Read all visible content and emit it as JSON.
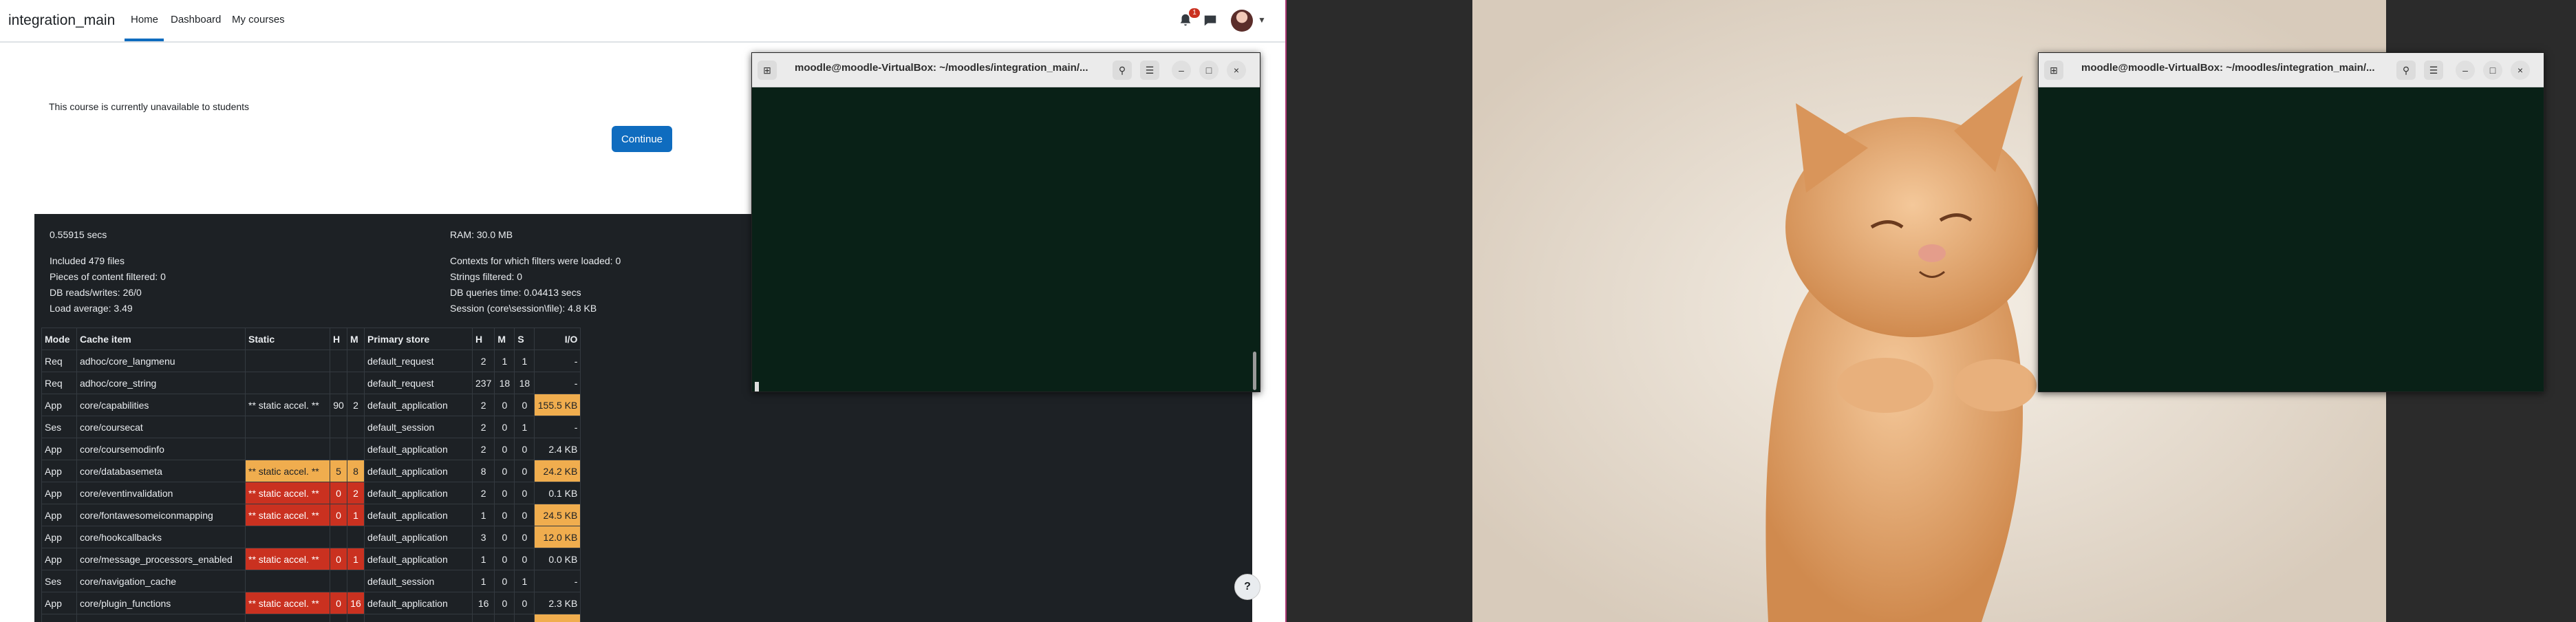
{
  "browser": {
    "site_name": "integration_main",
    "nav": [
      "Home",
      "Dashboard",
      "My courses"
    ],
    "notification_count": "1",
    "notice": "This course is currently unavailable to students",
    "continue_label": "Continue",
    "help_label": "?"
  },
  "perf": {
    "time": "0.55915 secs",
    "ram": "RAM: 30.0 MB",
    "included": "Included 479 files",
    "filtered": "Pieces of content filtered: 0",
    "db_rw": "DB reads/writes: 26/0",
    "load": "Load average: 3.49",
    "contexts": "Contexts for which filters were loaded: 0",
    "strings": "Strings filtered: 0",
    "db_time": "DB queries time: 0.04413 secs",
    "session": "Session (core\\session\\file): 4.8 KB"
  },
  "cache_table": {
    "headers": [
      "Mode",
      "Cache item",
      "Static",
      "H",
      "M",
      "Primary store",
      "H",
      "M",
      "S",
      "I/O"
    ],
    "rows": [
      {
        "mode": "Req",
        "item": "adhoc/core_langmenu",
        "static": "",
        "sh": "",
        "sm": "",
        "store": "default_request",
        "h": "2",
        "m": "1",
        "s": "1",
        "io": "-",
        "st": "",
        "ioc": ""
      },
      {
        "mode": "Req",
        "item": "adhoc/core_string",
        "static": "",
        "sh": "",
        "sm": "",
        "store": "default_request",
        "h": "237",
        "m": "18",
        "s": "18",
        "io": "-",
        "st": "",
        "ioc": ""
      },
      {
        "mode": "App",
        "item": "core/capabilities",
        "static": "** static accel. **",
        "sh": "90",
        "sm": "2",
        "store": "default_application",
        "h": "2",
        "m": "0",
        "s": "0",
        "io": "155.5 KB",
        "st": "",
        "ioc": "orange"
      },
      {
        "mode": "Ses",
        "item": "core/coursecat",
        "static": "",
        "sh": "",
        "sm": "",
        "store": "default_session",
        "h": "2",
        "m": "0",
        "s": "1",
        "io": "-",
        "st": "",
        "ioc": ""
      },
      {
        "mode": "App",
        "item": "core/coursemodinfo",
        "static": "",
        "sh": "",
        "sm": "",
        "store": "default_application",
        "h": "2",
        "m": "0",
        "s": "0",
        "io": "2.4 KB",
        "st": "",
        "ioc": ""
      },
      {
        "mode": "App",
        "item": "core/databasemeta",
        "static": "** static accel. **",
        "sh": "5",
        "sm": "8",
        "store": "default_application",
        "h": "8",
        "m": "0",
        "s": "0",
        "io": "24.2 KB",
        "st": "orange",
        "ioc": "orange"
      },
      {
        "mode": "App",
        "item": "core/eventinvalidation",
        "static": "** static accel. **",
        "sh": "0",
        "sm": "2",
        "store": "default_application",
        "h": "2",
        "m": "0",
        "s": "0",
        "io": "0.1 KB",
        "st": "red",
        "ioc": ""
      },
      {
        "mode": "App",
        "item": "core/fontawesomeiconmapping",
        "static": "** static accel. **",
        "sh": "0",
        "sm": "1",
        "store": "default_application",
        "h": "1",
        "m": "0",
        "s": "0",
        "io": "24.5 KB",
        "st": "red",
        "ioc": "orange"
      },
      {
        "mode": "App",
        "item": "core/hookcallbacks",
        "static": "",
        "sh": "",
        "sm": "",
        "store": "default_application",
        "h": "3",
        "m": "0",
        "s": "0",
        "io": "12.0 KB",
        "st": "",
        "ioc": "orange"
      },
      {
        "mode": "App",
        "item": "core/message_processors_enabled",
        "static": "** static accel. **",
        "sh": "0",
        "sm": "1",
        "store": "default_application",
        "h": "1",
        "m": "0",
        "s": "0",
        "io": "0.0 KB",
        "st": "red",
        "ioc": ""
      },
      {
        "mode": "Ses",
        "item": "core/navigation_cache",
        "static": "",
        "sh": "",
        "sm": "",
        "store": "default_session",
        "h": "1",
        "m": "0",
        "s": "1",
        "io": "-",
        "st": "",
        "ioc": ""
      },
      {
        "mode": "App",
        "item": "core/plugin_functions",
        "static": "** static accel. **",
        "sh": "0",
        "sm": "16",
        "store": "default_application",
        "h": "16",
        "m": "0",
        "s": "0",
        "io": "2.3 KB",
        "st": "red",
        "ioc": ""
      },
      {
        "mode": "",
        "item": "",
        "static": "",
        "sh": "",
        "sm": "",
        "store": "",
        "h": "",
        "m": "",
        "s": "",
        "io": "",
        "st": "",
        "ioc": "orange"
      }
    ]
  },
  "terminals": [
    {
      "title": "moodle@moodle-VirtualBox: ~/moodles/integration_main/..."
    },
    {
      "title": "moodle@moodle-VirtualBox: ~/moodles/integration_main/..."
    }
  ],
  "colors": {
    "accent": "#0f6cbf",
    "perf_bg": "#1d2125",
    "warn_red": "#ca3120",
    "warn_orange": "#f0ad4e",
    "terminal_bg": "#092117"
  }
}
